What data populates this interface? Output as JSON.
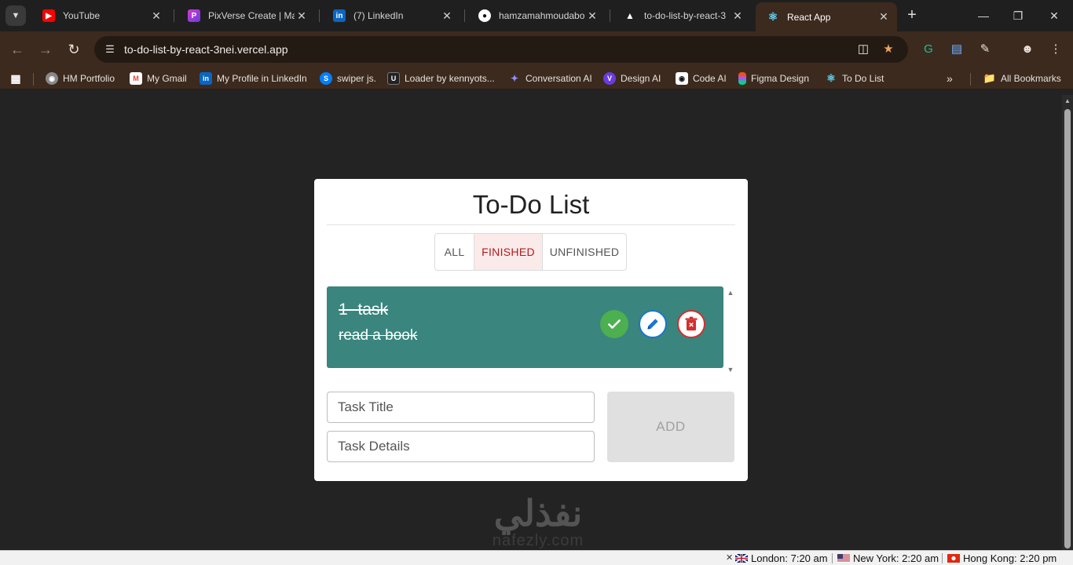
{
  "browser": {
    "tabs": [
      {
        "title": "YouTube",
        "active": false,
        "icon": "youtube-icon"
      },
      {
        "title": "PixVerse Create | Mak",
        "active": false,
        "icon": "pixverse-icon"
      },
      {
        "title": "(7) LinkedIn",
        "active": false,
        "icon": "linkedin-icon"
      },
      {
        "title": "hamzamahmoudabo",
        "active": false,
        "icon": "github-icon"
      },
      {
        "title": "to-do-list-by-react-3",
        "active": false,
        "icon": "vercel-icon"
      },
      {
        "title": "React App",
        "active": true,
        "icon": "react-icon"
      }
    ],
    "address": "to-do-list-by-react-3nei.vercel.app",
    "bookmarks": [
      {
        "label": "HM Portfolio",
        "icon": "globe-icon"
      },
      {
        "label": "My Gmail",
        "icon": "gmail-icon"
      },
      {
        "label": "My Profile in LinkedIn",
        "icon": "linkedin-icon"
      },
      {
        "label": "swiper js.",
        "icon": "swiper-icon"
      },
      {
        "label": "Loader by kennyots...",
        "icon": "uiverse-icon"
      },
      {
        "label": "Conversation AI",
        "icon": "conversation-ai-icon"
      },
      {
        "label": "Design AI",
        "icon": "design-ai-icon"
      },
      {
        "label": "Code AI",
        "icon": "code-ai-icon"
      },
      {
        "label": "Figma Design",
        "icon": "figma-icon"
      },
      {
        "label": "To Do List",
        "icon": "react-icon"
      }
    ],
    "all_bookmarks": "All Bookmarks",
    "colors": {
      "frame": "#3c2a1f",
      "tabstrip": "#1f1f1f"
    }
  },
  "app": {
    "title": "To-Do List",
    "filters": [
      {
        "label": "ALL",
        "selected": false
      },
      {
        "label": "FINISHED",
        "selected": true
      },
      {
        "label": "UNFINISHED",
        "selected": false
      }
    ],
    "tasks": [
      {
        "title": "1- task",
        "details": "read a book",
        "done": true
      }
    ],
    "inputs": {
      "title_placeholder": "Task Title",
      "details_placeholder": "Task Details"
    },
    "add_label": "ADD",
    "colors": {
      "task_bg": "#3a857d",
      "check": "#4caf50",
      "edit": "#1976d2",
      "delete": "#d32f2f",
      "selected_filter": "#b31b1b"
    }
  },
  "watermark": {
    "line1": "نفذلي",
    "line2": "nafezly.com"
  },
  "clocks": [
    {
      "city": "London: 7:20 am",
      "flag": "uk-flag-icon"
    },
    {
      "city": "New York: 2:20 am",
      "flag": "us-flag-icon"
    },
    {
      "city": "Hong Kong: 2:20 pm",
      "flag": "hk-flag-icon"
    }
  ]
}
